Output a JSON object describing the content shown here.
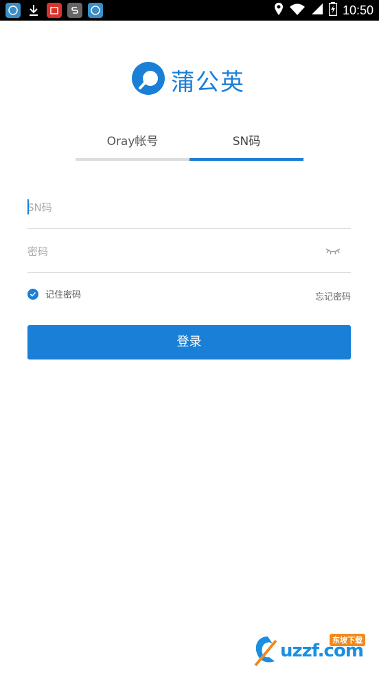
{
  "status_bar": {
    "time": "10:50",
    "notification_icons": [
      "app-icon",
      "download-icon",
      "store-icon",
      "s-app-icon",
      "app-icon"
    ],
    "status_icons": [
      "location-icon",
      "wifi-icon",
      "signal-icon",
      "battery-icon"
    ]
  },
  "logo": {
    "text": "蒲公英"
  },
  "tabs": [
    {
      "label": "Oray帐号",
      "selected": false
    },
    {
      "label": "SN码",
      "selected": true
    }
  ],
  "form": {
    "sn_placeholder": "SN码",
    "sn_value": "",
    "password_placeholder": "密码",
    "password_value": "",
    "remember_label": "记住密码",
    "remember_checked": true,
    "forgot_label": "忘记密码",
    "login_label": "登录"
  },
  "watermark": {
    "text": "uzzf.com",
    "badge": "东坡下载"
  },
  "colors": {
    "accent": "#1a7fd6",
    "divider": "#dddddd",
    "text_secondary": "#555555"
  }
}
